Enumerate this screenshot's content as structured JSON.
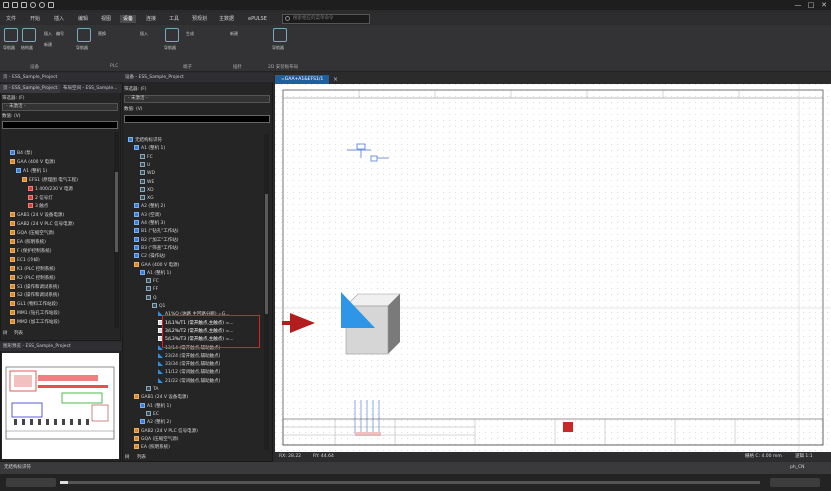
{
  "app": {
    "window_controls": [
      "—",
      "□",
      "✕"
    ],
    "menu": [
      {
        "label": "文件"
      },
      {
        "label": "开始"
      },
      {
        "label": "插入"
      },
      {
        "label": "编辑"
      },
      {
        "label": "视图"
      },
      {
        "label": "设备",
        "active": true
      },
      {
        "label": "连接"
      },
      {
        "label": "工具"
      },
      {
        "label": "预规划"
      },
      {
        "label": "主数据"
      },
      {
        "label": "ePULSE"
      }
    ],
    "search_placeholder": "搜索相应的菜单命令"
  },
  "ribbon": {
    "buttons": [
      {
        "label": "导航器",
        "icon": "navigator-icon"
      },
      {
        "label": "结构盒",
        "icon": "structure-box-icon"
      }
    ],
    "small_items": [
      {
        "label": "插入"
      },
      {
        "label": "编号"
      },
      {
        "label": "新建"
      },
      {
        "label": "导航器"
      },
      {
        "label": "替换"
      },
      {
        "label": "插入"
      },
      {
        "label": "导航器"
      },
      {
        "label": "生成"
      },
      {
        "label": "新建"
      },
      {
        "label": "导航器"
      }
    ],
    "groups": [
      {
        "label": "设备"
      },
      {
        "label": "PLC"
      },
      {
        "label": "端子"
      },
      {
        "label": "插针"
      },
      {
        "label": "2D 安装板布局"
      }
    ]
  },
  "left_panel": {
    "header": "页 - ESS_Sample_Project",
    "tab2": "布局空间 - ESS_Sample...",
    "filter_label": "筛选器: (F)",
    "filter_value": "- 未激活 -",
    "value_label": "数值: (V)",
    "tree": [
      {
        "text": "B4 (泵)",
        "indent": 1,
        "icon": "blue"
      },
      {
        "text": "GAA (400 V 电源)",
        "indent": 1,
        "icon": "orange"
      },
      {
        "text": "A1 (整机 1)",
        "indent": 2,
        "icon": "blue"
      },
      {
        "text": "EFS1 (原理图 电气工程)",
        "indent": 3,
        "icon": "orange"
      },
      {
        "text": "1 400/230 V 电源",
        "indent": 4,
        "icon": "red"
      },
      {
        "text": "2 信号灯",
        "indent": 4,
        "icon": "red"
      },
      {
        "text": "3 触点",
        "indent": 4,
        "icon": "red"
      },
      {
        "text": "GAB1 (24 V 设备电源)",
        "indent": 1,
        "icon": "orange"
      },
      {
        "text": "GAB2 (24 V PLC 信号电源)",
        "indent": 1,
        "icon": "orange"
      },
      {
        "text": "GQA (压缩空气源)",
        "indent": 1,
        "icon": "orange"
      },
      {
        "text": "EA (照明系统)",
        "indent": 1,
        "icon": "orange"
      },
      {
        "text": "F (保护控制系统)",
        "indent": 1,
        "icon": "orange"
      },
      {
        "text": "EC1 (冷却)",
        "indent": 1,
        "icon": "orange"
      },
      {
        "text": "K1 (PLC 控制系统)",
        "indent": 1,
        "icon": "orange"
      },
      {
        "text": "K2 (PLC 控制系统)",
        "indent": 1,
        "icon": "orange"
      },
      {
        "text": "S1 (操作和调试系统)",
        "indent": 1,
        "icon": "orange"
      },
      {
        "text": "S2 (操作和调试系统)",
        "indent": 1,
        "icon": "orange"
      },
      {
        "text": "GL1 (物料工作站段)",
        "indent": 1,
        "icon": "orange"
      },
      {
        "text": "MM1 (钻孔工作站段)",
        "indent": 1,
        "icon": "orange"
      },
      {
        "text": "MM2 (加工工作站段)",
        "indent": 1,
        "icon": "orange"
      }
    ],
    "bottom_tabs": [
      "树",
      "列表"
    ]
  },
  "preview_panel": {
    "header": "图形预览 - ESS_Sample_Project"
  },
  "middle_panel": {
    "header": "设备 - ESS_Sample_Project",
    "filter_label": "筛选器: (F)",
    "filter_value": "- 未激活 -",
    "value_label": "数值: (V)",
    "tree": [
      {
        "text": "无结构标识符",
        "indent": 0,
        "icon": "blue"
      },
      {
        "text": "A1 (整机 1)",
        "indent": 1,
        "icon": "blue"
      },
      {
        "text": "FC",
        "indent": 2,
        "icon": "box"
      },
      {
        "text": "U",
        "indent": 2,
        "icon": "box"
      },
      {
        "text": "WD",
        "indent": 2,
        "icon": "box"
      },
      {
        "text": "WE",
        "indent": 2,
        "icon": "box"
      },
      {
        "text": "XD",
        "indent": 2,
        "icon": "box"
      },
      {
        "text": "XG",
        "indent": 2,
        "icon": "box"
      },
      {
        "text": "A2 (整机 2)",
        "indent": 1,
        "icon": "blue"
      },
      {
        "text": "A3 (空调)",
        "indent": 1,
        "icon": "blue"
      },
      {
        "text": "A4 (整机 3)",
        "indent": 1,
        "icon": "blue"
      },
      {
        "text": "B1 (\"钻孔\"工作站)",
        "indent": 1,
        "icon": "blue"
      },
      {
        "text": "B2 (\"加工\"工作站)",
        "indent": 1,
        "icon": "blue"
      },
      {
        "text": "B3 (\"筛查\"工作站)",
        "indent": 1,
        "icon": "blue"
      },
      {
        "text": "C2 (操作站)",
        "indent": 1,
        "icon": "blue"
      },
      {
        "text": "GAA (400 V 电源)",
        "indent": 1,
        "icon": "orange"
      },
      {
        "text": "A1 (整机 1)",
        "indent": 2,
        "icon": "blue"
      },
      {
        "text": "FC",
        "indent": 3,
        "icon": "box"
      },
      {
        "text": "FF",
        "indent": 3,
        "icon": "box"
      },
      {
        "text": "Q",
        "indent": 3,
        "icon": "box"
      },
      {
        "text": "Q1",
        "indent": 4,
        "icon": "box"
      },
      {
        "text": "A1%Q (油路 主回路分断) =G...",
        "indent": 5,
        "icon": "tri"
      },
      {
        "text": "1/L1%/T1 (常开触点,主触点) =...",
        "indent": 5,
        "icon": "cube",
        "highlight": true
      },
      {
        "text": "3/L2%/T2 (常开触点,主触点) =...",
        "indent": 5,
        "icon": "cube",
        "highlight": true
      },
      {
        "text": "5/L3%/T3 (常开触点,主触点) =...",
        "indent": 5,
        "icon": "cube",
        "highlight": true
      },
      {
        "text": "13/14 (常开触点,辅助触点)",
        "indent": 5,
        "icon": "tri"
      },
      {
        "text": "23/24 (常开触点,辅助触点)",
        "indent": 5,
        "icon": "tri"
      },
      {
        "text": "33/34 (常开触点,辅助触点)",
        "indent": 5,
        "icon": "tri"
      },
      {
        "text": "11/12 (常闭触点,辅助触点)",
        "indent": 5,
        "icon": "tri"
      },
      {
        "text": "21/22 (常闭触点,辅助触点)",
        "indent": 5,
        "icon": "tri"
      },
      {
        "text": "TA",
        "indent": 3,
        "icon": "box"
      },
      {
        "text": "GAB1 (24 V 设备电源)",
        "indent": 1,
        "icon": "orange"
      },
      {
        "text": "A1 (整机 1)",
        "indent": 2,
        "icon": "blue"
      },
      {
        "text": "EC",
        "indent": 3,
        "icon": "box"
      },
      {
        "text": "A2 (整机 2)",
        "indent": 2,
        "icon": "blue"
      },
      {
        "text": "GAB2 (24 V PLC 信号电源)",
        "indent": 1,
        "icon": "orange"
      },
      {
        "text": "GQA (压缩空气源)",
        "indent": 1,
        "icon": "orange"
      },
      {
        "text": "EA (照明系统)",
        "indent": 1,
        "icon": "orange"
      }
    ],
    "bottom_tabs": [
      "树",
      "列表"
    ]
  },
  "document": {
    "tab_label": "=GAA+A1&EFS1/1"
  },
  "status": {
    "coords": "RX: 28.22",
    "coords2": "RY: 44.64",
    "grid": "栅格 C: 4.00 mm",
    "logic": "逻辑 1:1",
    "bottom_left": "无结构标识符",
    "bottom_right": "ph_CN"
  }
}
